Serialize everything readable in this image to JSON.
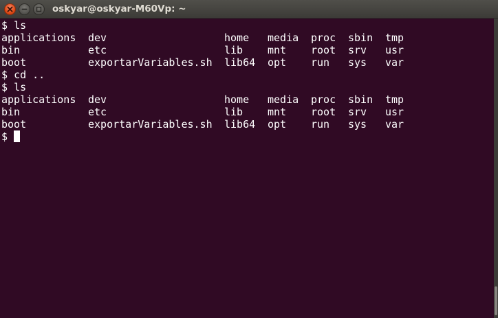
{
  "window": {
    "title": "oskyar@oskyar-M60Vp: ~"
  },
  "icons": {
    "close": "close-icon",
    "minimize": "minimize-icon",
    "maximize": "maximize-icon"
  },
  "colors": {
    "terminal_bg": "#300a24",
    "text": "#ffffff",
    "close_button": "#df4a16"
  },
  "terminal": {
    "prompt": "$ ",
    "commands": [
      "ls",
      "cd ..",
      "ls"
    ],
    "listing_1": [
      [
        "applications",
        "dev",
        "home",
        "media",
        "proc",
        "sbin",
        "tmp"
      ],
      [
        "bin",
        "etc",
        "lib",
        "mnt",
        "root",
        "srv",
        "usr"
      ],
      [
        "boot",
        "exportarVariables.sh",
        "lib64",
        "opt",
        "run",
        "sys",
        "var"
      ]
    ],
    "listing_2": [
      [
        "applications",
        "dev",
        "home",
        "media",
        "proc",
        "sbin",
        "tmp"
      ],
      [
        "bin",
        "etc",
        "lib",
        "mnt",
        "root",
        "srv",
        "usr"
      ],
      [
        "boot",
        "exportarVariables.sh",
        "lib64",
        "opt",
        "run",
        "sys",
        "var"
      ]
    ]
  }
}
